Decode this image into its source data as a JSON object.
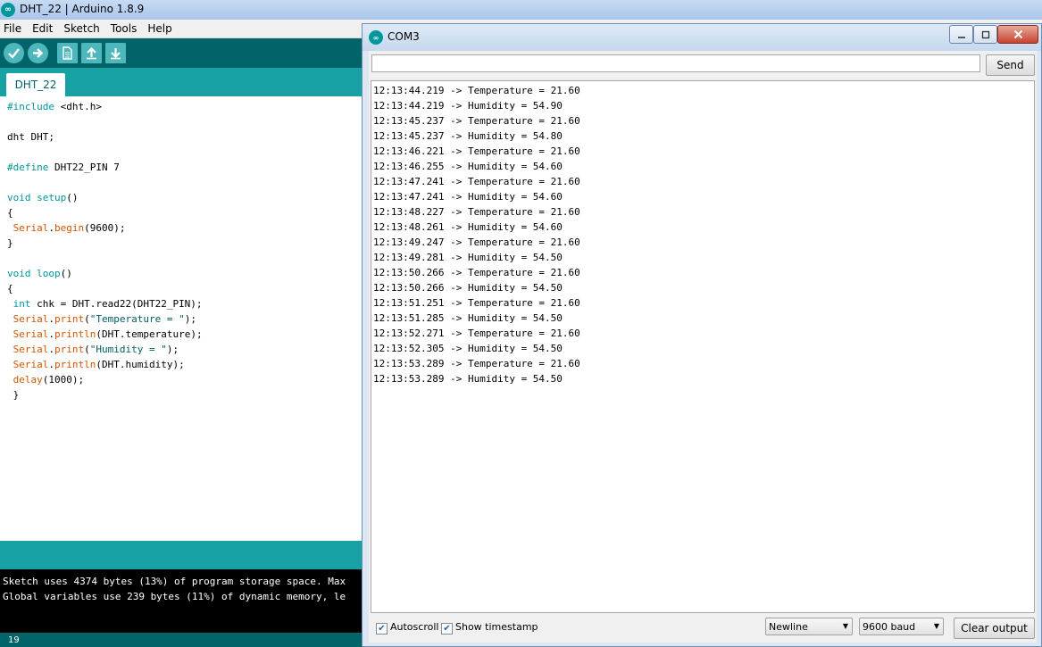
{
  "ide": {
    "title": "DHT_22 | Arduino 1.8.9",
    "menu": [
      "File",
      "Edit",
      "Sketch",
      "Tools",
      "Help"
    ],
    "tab": "DHT_22",
    "code": [
      [
        [
          "kw",
          "#include"
        ],
        [
          "",
          " <dht.h>"
        ]
      ],
      [],
      [
        [
          "",
          "dht DHT;"
        ]
      ],
      [],
      [
        [
          "kw",
          "#define"
        ],
        [
          "",
          " DHT22_PIN 7"
        ]
      ],
      [],
      [
        [
          "kw",
          "void"
        ],
        [
          "",
          " "
        ],
        [
          "kw",
          "setup"
        ],
        [
          "",
          "()"
        ]
      ],
      [
        [
          "",
          "{"
        ]
      ],
      [
        [
          "",
          " "
        ],
        [
          "fn",
          "Serial"
        ],
        [
          "",
          "."
        ],
        [
          "fn",
          "begin"
        ],
        [
          "",
          "(9600);"
        ]
      ],
      [
        [
          "",
          "}"
        ]
      ],
      [],
      [
        [
          "kw",
          "void"
        ],
        [
          "",
          " "
        ],
        [
          "kw",
          "loop"
        ],
        [
          "",
          "()"
        ]
      ],
      [
        [
          "",
          "{"
        ]
      ],
      [
        [
          "",
          " "
        ],
        [
          "kw",
          "int"
        ],
        [
          "",
          " chk = DHT.read22(DHT22_PIN);"
        ]
      ],
      [
        [
          "",
          " "
        ],
        [
          "fn",
          "Serial"
        ],
        [
          "",
          "."
        ],
        [
          "fn",
          "print"
        ],
        [
          "",
          "("
        ],
        [
          "st",
          "\"Temperature = \""
        ],
        [
          "",
          ");"
        ]
      ],
      [
        [
          "",
          " "
        ],
        [
          "fn",
          "Serial"
        ],
        [
          "",
          "."
        ],
        [
          "fn",
          "println"
        ],
        [
          "",
          "(DHT.temperature);"
        ]
      ],
      [
        [
          "",
          " "
        ],
        [
          "fn",
          "Serial"
        ],
        [
          "",
          "."
        ],
        [
          "fn",
          "print"
        ],
        [
          "",
          "("
        ],
        [
          "st",
          "\"Humidity = \""
        ],
        [
          "",
          ");"
        ]
      ],
      [
        [
          "",
          " "
        ],
        [
          "fn",
          "Serial"
        ],
        [
          "",
          "."
        ],
        [
          "fn",
          "println"
        ],
        [
          "",
          "(DHT.humidity);"
        ]
      ],
      [
        [
          "",
          " "
        ],
        [
          "fn",
          "delay"
        ],
        [
          "",
          "(1000);"
        ]
      ],
      [
        [
          "",
          " }"
        ]
      ]
    ],
    "console": [
      "Sketch uses 4374 bytes (13%) of program storage space. Max",
      "Global variables use 239 bytes (11%) of dynamic memory, le"
    ],
    "footer_line": "19",
    "icons": [
      "verify-icon",
      "upload-icon",
      "new-icon",
      "open-icon",
      "save-icon"
    ]
  },
  "serial_monitor": {
    "title": "COM3",
    "input_value": "",
    "send_label": "Send",
    "output": [
      "12:13:44.219 -> Temperature = 21.60",
      "12:13:44.219 -> Humidity = 54.90",
      "12:13:45.237 -> Temperature = 21.60",
      "12:13:45.237 -> Humidity = 54.80",
      "12:13:46.221 -> Temperature = 21.60",
      "12:13:46.255 -> Humidity = 54.60",
      "12:13:47.241 -> Temperature = 21.60",
      "12:13:47.241 -> Humidity = 54.60",
      "12:13:48.227 -> Temperature = 21.60",
      "12:13:48.261 -> Humidity = 54.60",
      "12:13:49.247 -> Temperature = 21.60",
      "12:13:49.281 -> Humidity = 54.50",
      "12:13:50.266 -> Temperature = 21.60",
      "12:13:50.266 -> Humidity = 54.50",
      "12:13:51.251 -> Temperature = 21.60",
      "12:13:51.285 -> Humidity = 54.50",
      "12:13:52.271 -> Temperature = 21.60",
      "12:13:52.305 -> Humidity = 54.50",
      "12:13:53.289 -> Temperature = 21.60",
      "12:13:53.289 -> Humidity = 54.50"
    ],
    "autoscroll_label": "Autoscroll",
    "autoscroll_checked": true,
    "timestamp_label": "Show timestamp",
    "timestamp_checked": true,
    "line_ending": "Newline",
    "baud": "9600 baud",
    "clear_label": "Clear output"
  },
  "colors": {
    "toolbar": "#006468",
    "tabbar": "#17a1a5",
    "keyword": "#00979c",
    "function": "#d35400"
  }
}
